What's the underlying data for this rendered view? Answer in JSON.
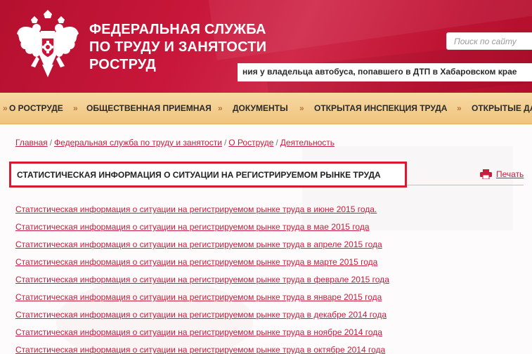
{
  "header": {
    "title_lines": [
      "ФЕДЕРАЛЬНАЯ СЛУЖБА",
      "ПО ТРУДУ И ЗАНЯТОСТИ",
      "РОСТРУД"
    ],
    "search_placeholder": "Поиск по сайту",
    "ticker": "ния у владельца автобуса, попавшего в ДТП в Хабаровском крае"
  },
  "nav": {
    "items": [
      "О РОСТРУДЕ",
      "ОБЩЕСТВЕННАЯ ПРИЕМНАЯ",
      "ДОКУМЕНТЫ",
      "ОТКРЫТАЯ ИНСПЕКЦИЯ ТРУДА",
      "ОТКРЫТЫЕ ДА"
    ],
    "separator": "»"
  },
  "breadcrumb": {
    "items": [
      "Главная",
      "Федеральная служба по труду и занятости",
      "О Роструде",
      "Деятельность"
    ],
    "separator": "/"
  },
  "page": {
    "title": "СТАТИСТИЧЕСКАЯ ИНФОРМАЦИЯ О СИТУАЦИИ НА РЕГИСТРИРУЕМОМ РЫНКЕ ТРУДА",
    "print_label": "Печать"
  },
  "links": [
    "Статистическая информация о ситуации на регистрируемом рынке труда в июне 2015 года.",
    "Статистическая информация о ситуации на регистрируемом рынке труда в мае 2015 года",
    "Статистическая информация о ситуации на регистрируемом рынке труда в апреле 2015 года",
    "Статистическая информация о ситуации на регистрируемом рынке труда в марте 2015 года",
    "Статистическая информация о ситуации на регистрируемом рынке труда в феврале 2015 года",
    "Статистическая информация о ситуации на регистрируемом рынке труда в январе 2015 года",
    "Статистическая информация о ситуации на регистрируемом рынке труда в декабре 2014 года",
    "Статистическая информация о ситуации на регистрируемом рынке труда в ноябре 2014 года",
    "Статистическая информация о ситуации на регистрируемом рынке труда в октябре 2014 года"
  ],
  "colors": {
    "header_red": "#c8173a",
    "nav_orange": "#efc47e",
    "link_red": "#c41f3e",
    "highlight_border": "#d9192f"
  }
}
